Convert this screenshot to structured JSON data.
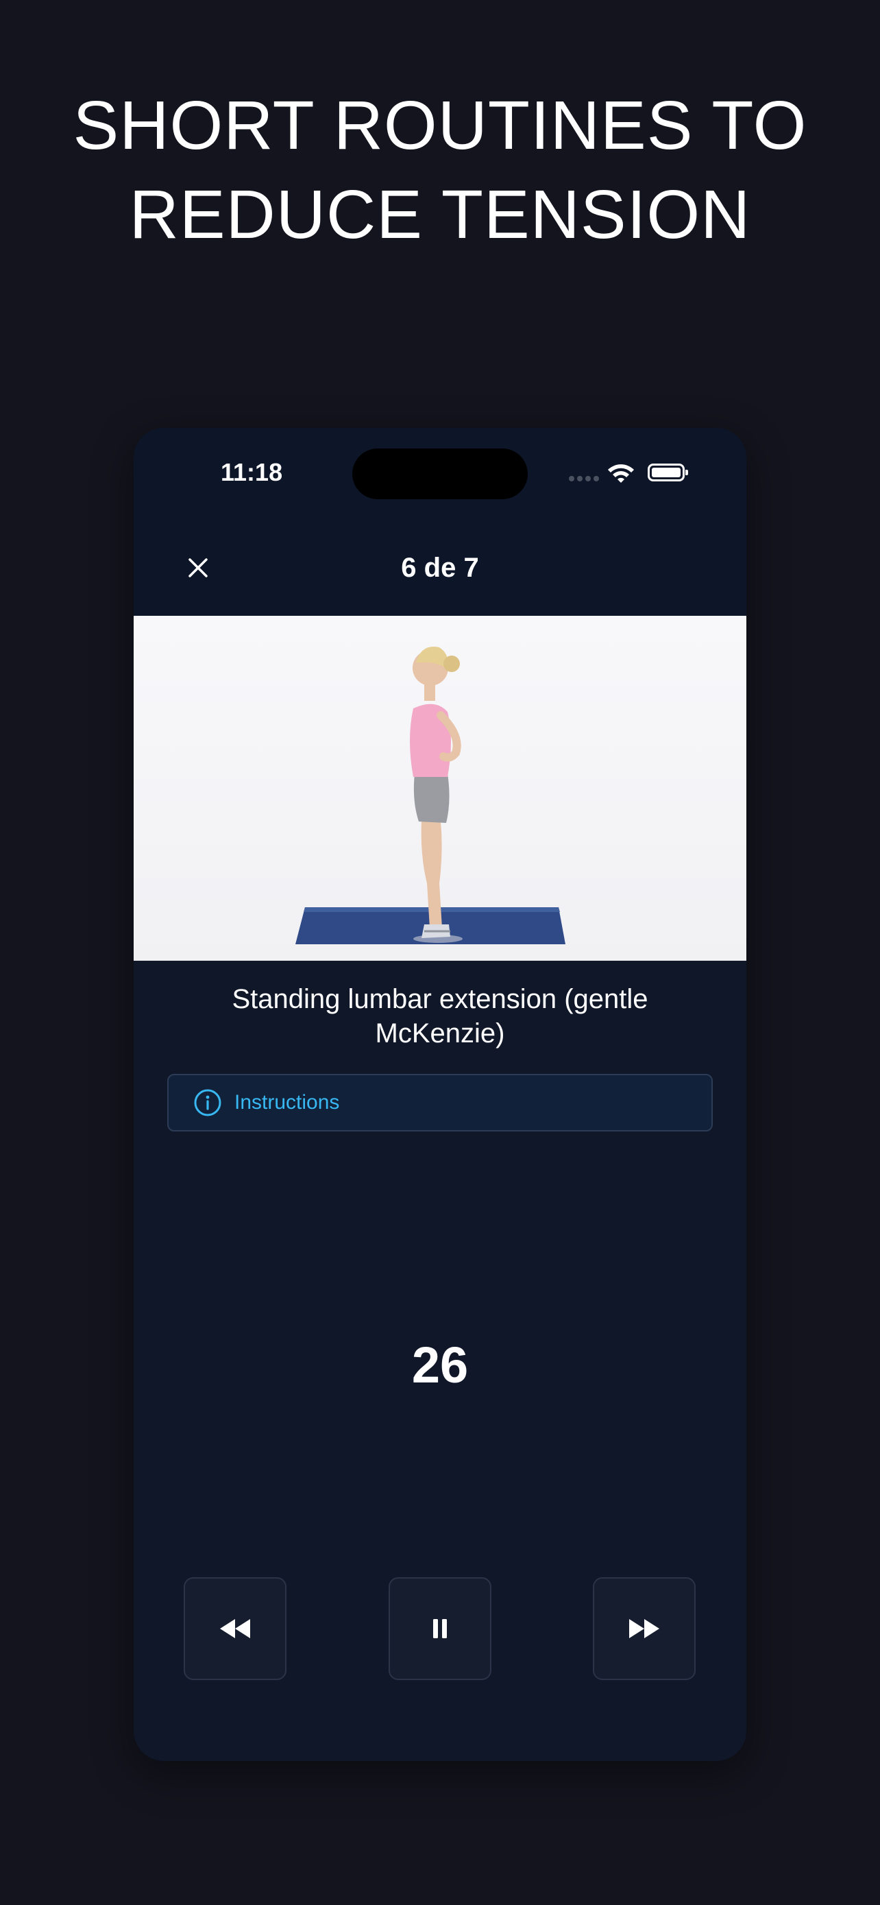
{
  "headline": {
    "line1": "SHORT ROUTINES TO",
    "line2": "REDUCE TENSION"
  },
  "status_bar": {
    "time": "11:18",
    "icons": [
      "signal-dots-icon",
      "wifi-icon",
      "battery-icon"
    ]
  },
  "header": {
    "close_icon": "close-icon",
    "progress": "6 de 7"
  },
  "exercise": {
    "video_icon": "exercise-video",
    "name": "Standing lumbar extension (gentle McKenzie)",
    "instructions_label": "Instructions",
    "instructions_icon": "info-icon"
  },
  "timer": {
    "value": "26"
  },
  "controls": {
    "previous_icon": "rewind-icon",
    "pause_icon": "pause-icon",
    "next_icon": "fast-forward-icon"
  },
  "colors": {
    "page_bg": "#14141e",
    "phone_bg": "#101729",
    "accent": "#38b8f2",
    "text": "#ffffff"
  }
}
